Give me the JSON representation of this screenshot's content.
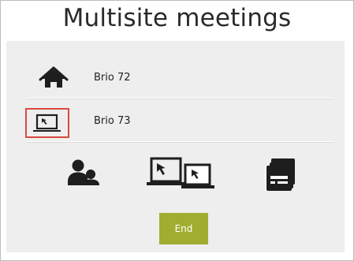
{
  "header": {
    "title": "Multisite meetings"
  },
  "sites": [
    {
      "label": "Brio 72",
      "icon": "home-icon",
      "selected": false
    },
    {
      "label": "Brio 73",
      "icon": "laptop-icon",
      "selected": true
    }
  ],
  "actions": [
    {
      "icon": "contacts-icon"
    },
    {
      "icon": "share-screen-icon"
    },
    {
      "icon": "contact-cards-icon"
    }
  ],
  "end_button": {
    "label": "End"
  },
  "colors": {
    "accent": "#a1ad30",
    "selection": "#d94a3d",
    "panel": "#eeeeee",
    "icon": "#222222"
  }
}
